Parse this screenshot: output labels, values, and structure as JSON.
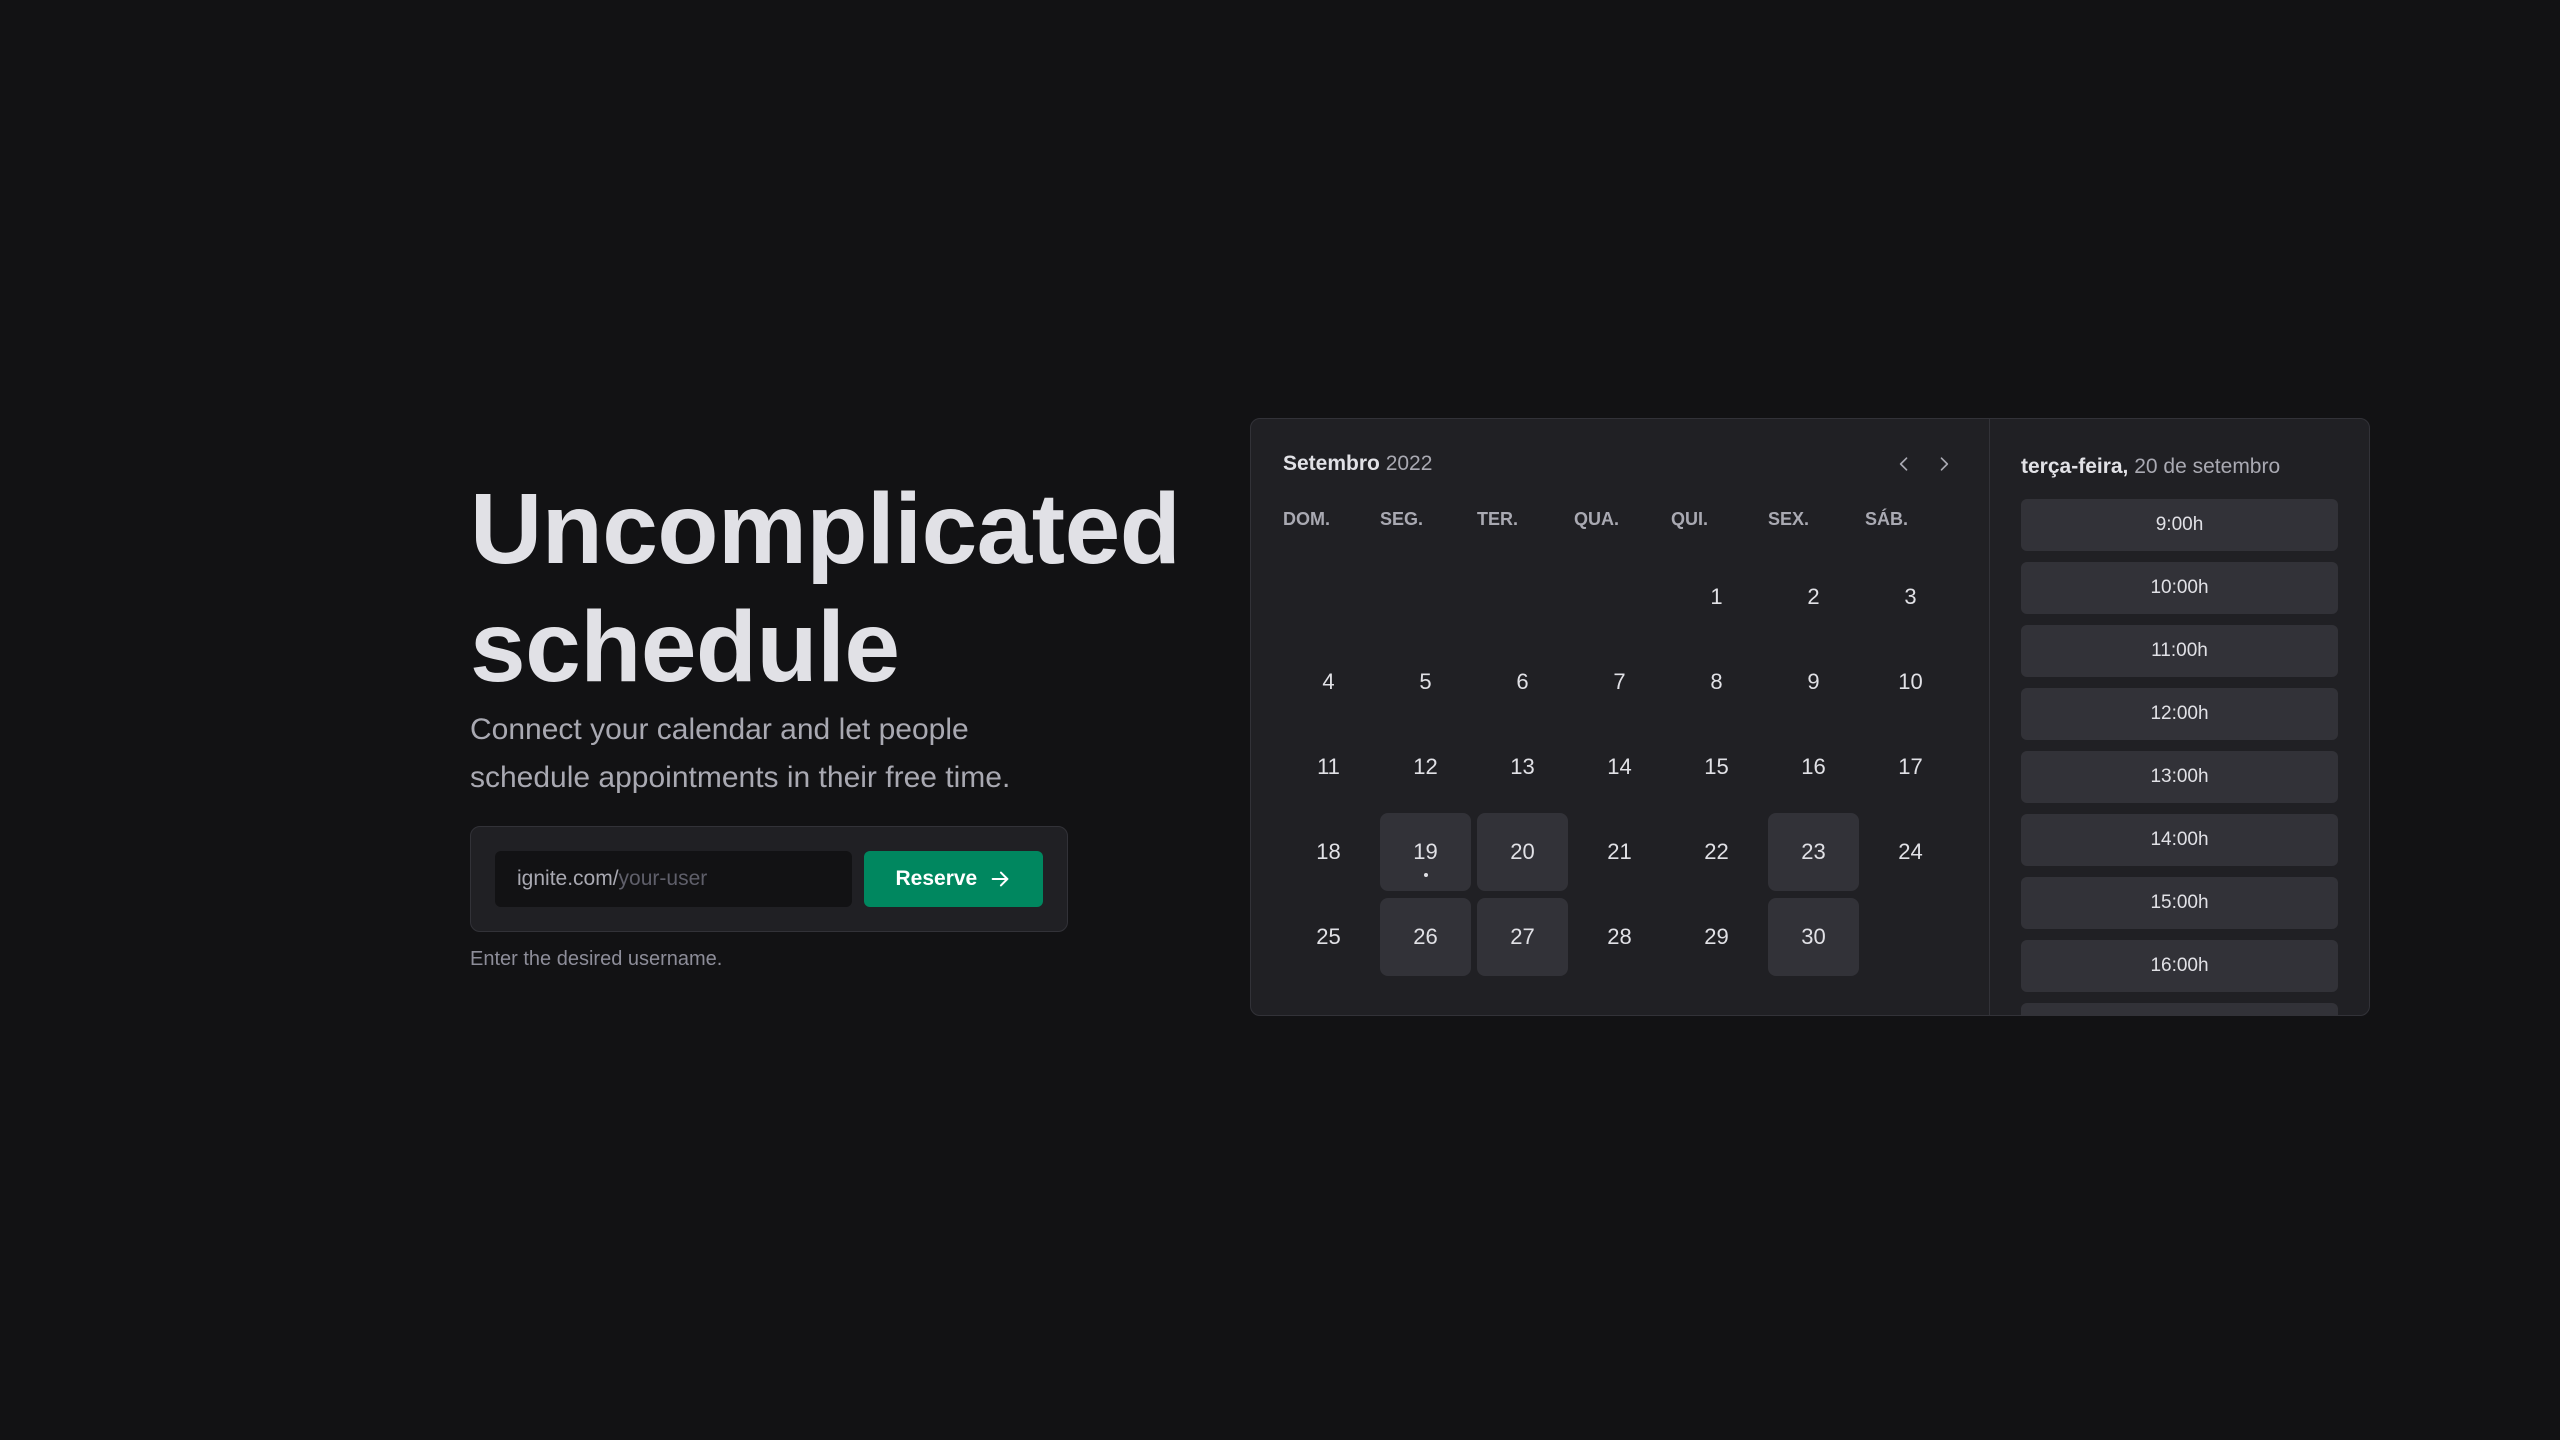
{
  "hero": {
    "title_line1": "Uncomplicated",
    "title_line2": "schedule",
    "subtitle": "Connect your calendar and let people schedule appointments in their free time."
  },
  "claim_form": {
    "prefix": "ignite.com/",
    "placeholder": "your-user",
    "button_label": "Reserve",
    "hint": "Enter the desired username."
  },
  "calendar": {
    "month": "Setembro",
    "year": "2022",
    "weekdays": [
      "DOM.",
      "SEG.",
      "TER.",
      "QUA.",
      "QUI.",
      "SEX.",
      "SÁB."
    ],
    "days": [
      {
        "label": "",
        "available": false
      },
      {
        "label": "",
        "available": false
      },
      {
        "label": "",
        "available": false
      },
      {
        "label": "",
        "available": false
      },
      {
        "label": "1",
        "available": false
      },
      {
        "label": "2",
        "available": false
      },
      {
        "label": "3",
        "available": false
      },
      {
        "label": "4",
        "available": false
      },
      {
        "label": "5",
        "available": false
      },
      {
        "label": "6",
        "available": false
      },
      {
        "label": "7",
        "available": false
      },
      {
        "label": "8",
        "available": false
      },
      {
        "label": "9",
        "available": false
      },
      {
        "label": "10",
        "available": false
      },
      {
        "label": "11",
        "available": false
      },
      {
        "label": "12",
        "available": false
      },
      {
        "label": "13",
        "available": false
      },
      {
        "label": "14",
        "available": false
      },
      {
        "label": "15",
        "available": false
      },
      {
        "label": "16",
        "available": false
      },
      {
        "label": "17",
        "available": false
      },
      {
        "label": "18",
        "available": false
      },
      {
        "label": "19",
        "available": true,
        "today": true
      },
      {
        "label": "20",
        "available": true
      },
      {
        "label": "21",
        "available": false
      },
      {
        "label": "22",
        "available": false
      },
      {
        "label": "23",
        "available": true
      },
      {
        "label": "24",
        "available": false
      },
      {
        "label": "25",
        "available": false
      },
      {
        "label": "26",
        "available": true
      },
      {
        "label": "27",
        "available": true
      },
      {
        "label": "28",
        "available": false
      },
      {
        "label": "29",
        "available": false
      },
      {
        "label": "30",
        "available": true
      }
    ]
  },
  "time_picker": {
    "weekday": "terça-feira,",
    "date": "20 de setembro",
    "slots": [
      "9:00h",
      "10:00h",
      "11:00h",
      "12:00h",
      "13:00h",
      "14:00h",
      "15:00h",
      "16:00h",
      ""
    ]
  },
  "colors": {
    "background": "#121214",
    "card": "#202024",
    "available_day": "#323238",
    "accent": "#00875f"
  }
}
